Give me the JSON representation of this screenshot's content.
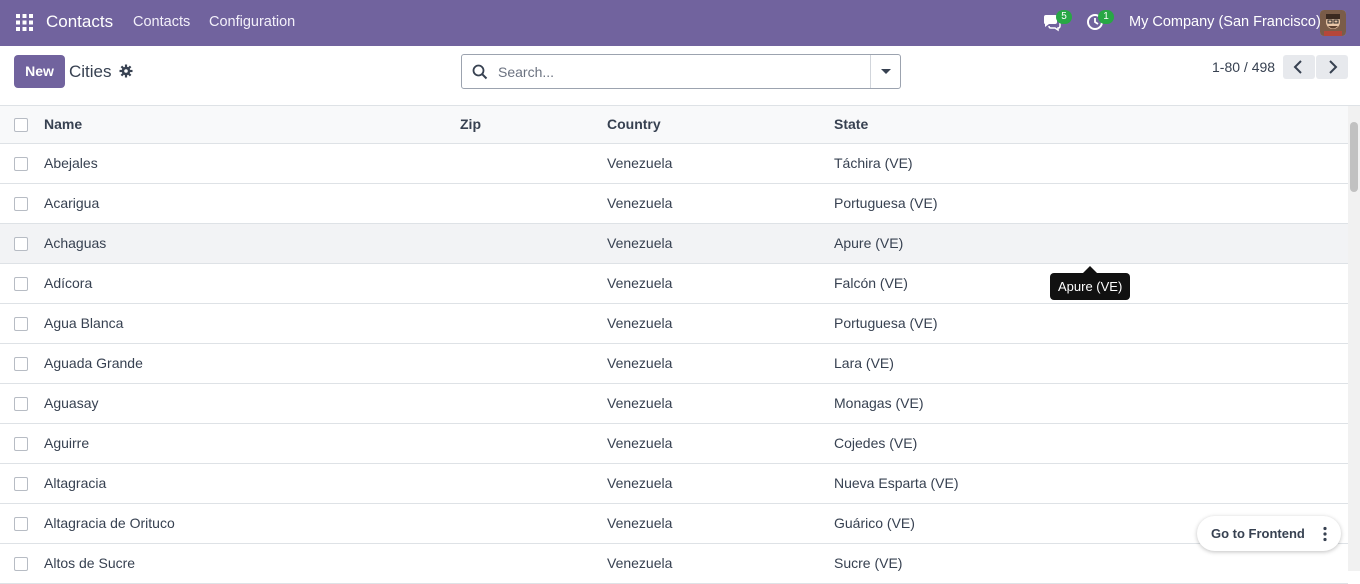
{
  "navbar": {
    "app_name": "Contacts",
    "menu": [
      "Contacts",
      "Configuration"
    ],
    "messages_count": "5",
    "activities_count": "1",
    "company": "My Company (San Francisco)",
    "color": "#71639e"
  },
  "control": {
    "new_label": "New",
    "title": "Cities",
    "search_placeholder": "Search...",
    "pager": "1-80 / 498"
  },
  "table": {
    "columns": [
      "Name",
      "Zip",
      "Country",
      "State"
    ],
    "rows": [
      {
        "name": "Abejales",
        "zip": "",
        "country": "Venezuela",
        "state": "Táchira (VE)"
      },
      {
        "name": "Acarigua",
        "zip": "",
        "country": "Venezuela",
        "state": "Portuguesa (VE)"
      },
      {
        "name": "Achaguas",
        "zip": "",
        "country": "Venezuela",
        "state": "Apure (VE)"
      },
      {
        "name": "Adícora",
        "zip": "",
        "country": "Venezuela",
        "state": "Falcón (VE)"
      },
      {
        "name": "Agua Blanca",
        "zip": "",
        "country": "Venezuela",
        "state": "Portuguesa (VE)"
      },
      {
        "name": "Aguada Grande",
        "zip": "",
        "country": "Venezuela",
        "state": "Lara (VE)"
      },
      {
        "name": "Aguasay",
        "zip": "",
        "country": "Venezuela",
        "state": "Monagas (VE)"
      },
      {
        "name": "Aguirre",
        "zip": "",
        "country": "Venezuela",
        "state": "Cojedes (VE)"
      },
      {
        "name": "Altagracia",
        "zip": "",
        "country": "Venezuela",
        "state": "Nueva Esparta (VE)"
      },
      {
        "name": "Altagracia de Orituco",
        "zip": "",
        "country": "Venezuela",
        "state": "Guárico (VE)"
      },
      {
        "name": "Altos de Sucre",
        "zip": "",
        "country": "Venezuela",
        "state": "Sucre (VE)"
      }
    ]
  },
  "tooltip": "Apure (VE)",
  "frontend_label": "Go to Frontend"
}
